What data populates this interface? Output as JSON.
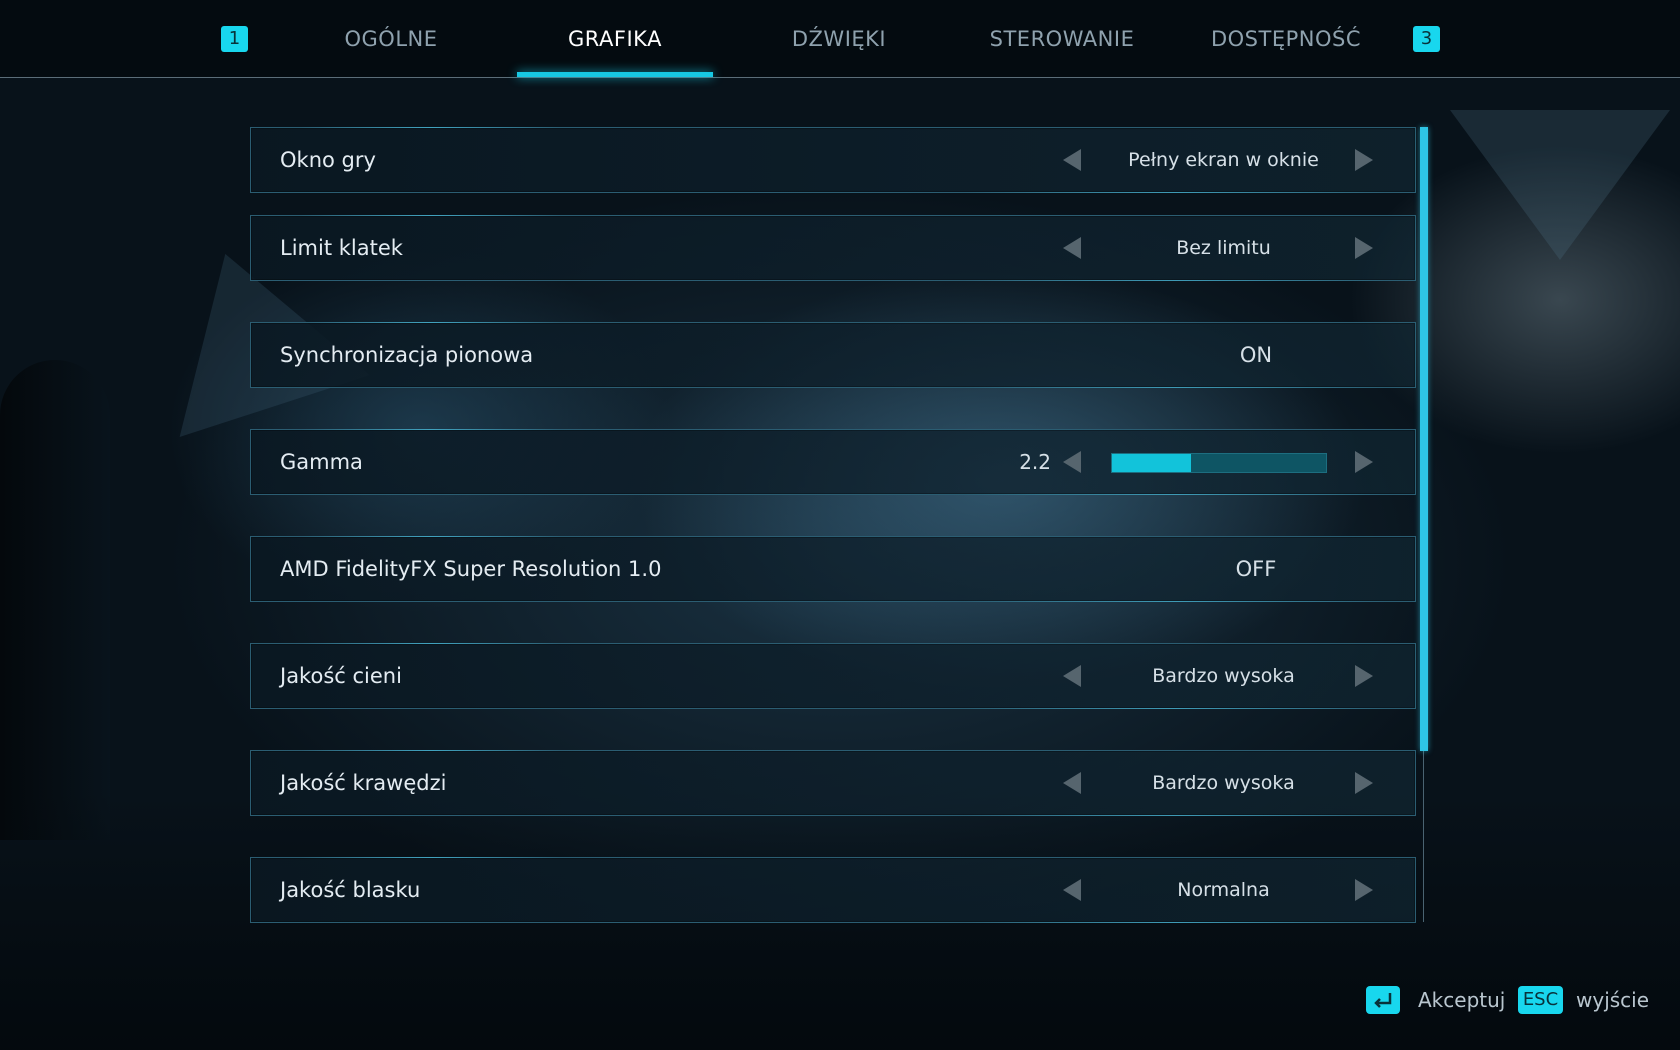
{
  "tabs": {
    "prev_key": "1",
    "next_key": "3",
    "items": [
      {
        "label": "OGÓLNE"
      },
      {
        "label": "GRAFIKA"
      },
      {
        "label": "DŹWIĘKI"
      },
      {
        "label": "STEROWANIE"
      },
      {
        "label": "DOSTĘPNOŚĆ"
      }
    ],
    "active_tab": "GRAFIKA"
  },
  "settings": [
    {
      "label": "Okno gry",
      "value": "Pełny ekran w oknie",
      "control": "selector"
    },
    {
      "label": "Limit klatek",
      "value": "Bez limitu",
      "control": "selector"
    },
    {
      "label": "Synchronizacja pionowa",
      "value": "ON",
      "control": "toggle"
    },
    {
      "label": "Gamma",
      "value": "2.2",
      "control": "slider",
      "slider_fraction": 0.37
    },
    {
      "label": "AMD FidelityFX Super Resolution 1.0",
      "value": "OFF",
      "control": "toggle"
    },
    {
      "label": "Jakość cieni",
      "value": "Bardzo wysoka",
      "control": "selector"
    },
    {
      "label": "Jakość krawędzi",
      "value": "Bardzo wysoka",
      "control": "selector"
    },
    {
      "label": "Jakość blasku",
      "value": "Normalna",
      "control": "selector"
    }
  ],
  "footer": {
    "accept_label": "Akceptuj",
    "accept_icon": "enter-key-icon",
    "exit_key": "ESC",
    "exit_label": "wyjście"
  },
  "colors": {
    "accent": "#17c9e4",
    "slider_fill": "#12c3da",
    "slider_track": "#0e5564"
  }
}
